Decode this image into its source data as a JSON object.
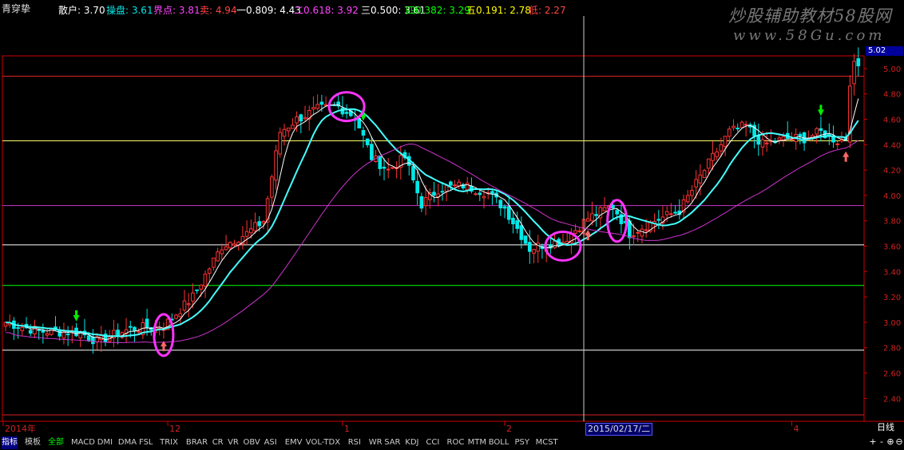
{
  "header": {
    "stock_name": "青穿挚",
    "retail": {
      "label": "散户:",
      "value": "3.70",
      "color": "#ffffff"
    },
    "operator": {
      "label": "操盘:",
      "value": "3.61",
      "color": "#00e8e8"
    },
    "boundary": {
      "label": "界点:",
      "value": "3.81",
      "color": "#ff44ff"
    },
    "sell": {
      "label": "卖:",
      "value": "4.94",
      "color": "#ff4444"
    },
    "fib1": {
      "label": "一0.809:",
      "value": "4.43",
      "color": "#ffffff"
    },
    "fib2": {
      "label": "二0.618:",
      "value": "3.92",
      "color": "#ff44ff"
    },
    "fib3": {
      "label": "三0.500:",
      "value": "3.61",
      "color": "#ffffff"
    },
    "fib4": {
      "label": "四0.382:",
      "value": "3.29",
      "color": "#00ff00"
    },
    "fib5": {
      "label": "五0.191:",
      "value": "2.78",
      "color": "#ffff00"
    },
    "low": {
      "label": "低:",
      "value": "2.27",
      "color": "#ff4444"
    }
  },
  "watermark": {
    "line1": "炒股辅助教材58股网",
    "line2": "www.58Gu.com"
  },
  "price_box": "5.02",
  "period_label": "日线",
  "cursor_date": "2015/02/17/二",
  "colors": {
    "up": "#ff3333",
    "down": "#00e8e8",
    "ma_white": "#ffffff",
    "ma_cyan": "#44ffff",
    "ma_magenta": "#cc33cc",
    "axis": "#cc0000"
  },
  "chart_data": {
    "type": "candlestick",
    "ylim": [
      2.27,
      5.1
    ],
    "y_ticks": [
      "5.00",
      "4.80",
      "4.60",
      "4.40",
      "4.20",
      "4.00",
      "3.80",
      "3.60",
      "3.40",
      "3.20",
      "3.00",
      "2.80",
      "2.60",
      "2.40"
    ],
    "x_labels": [
      {
        "label": "2014年",
        "index": 0
      },
      {
        "label": "12",
        "index": 39
      },
      {
        "label": "1",
        "index": 81
      },
      {
        "label": "2",
        "index": 120
      },
      {
        "label": "4",
        "index": 189
      }
    ],
    "cursor_index": 139,
    "reference_lines": [
      {
        "value": 4.94,
        "color": "#dd2222"
      },
      {
        "value": 4.43,
        "color": "#ffff66"
      },
      {
        "value": 3.92,
        "color": "#cc33cc"
      },
      {
        "value": 3.61,
        "color": "#ffffff"
      },
      {
        "value": 3.29,
        "color": "#00ff00"
      },
      {
        "value": 2.78,
        "color": "#ffffff"
      },
      {
        "value": 2.27,
        "color": "#dd2222"
      }
    ],
    "close_keys": [
      [
        0,
        3.0
      ],
      [
        8,
        2.93
      ],
      [
        18,
        2.92
      ],
      [
        22,
        2.85
      ],
      [
        30,
        2.95
      ],
      [
        38,
        2.97
      ],
      [
        45,
        3.2
      ],
      [
        52,
        3.6
      ],
      [
        58,
        3.7
      ],
      [
        62,
        3.8
      ],
      [
        66,
        4.5
      ],
      [
        70,
        4.6
      ],
      [
        75,
        4.68
      ],
      [
        80,
        4.7
      ],
      [
        84,
        4.62
      ],
      [
        88,
        4.3
      ],
      [
        92,
        4.2
      ],
      [
        96,
        4.3
      ],
      [
        100,
        3.93
      ],
      [
        104,
        4.05
      ],
      [
        110,
        4.08
      ],
      [
        116,
        4.02
      ],
      [
        120,
        3.9
      ],
      [
        126,
        3.58
      ],
      [
        130,
        3.62
      ],
      [
        134,
        3.64
      ],
      [
        140,
        3.82
      ],
      [
        146,
        3.92
      ],
      [
        150,
        3.7
      ],
      [
        156,
        3.8
      ],
      [
        162,
        3.88
      ],
      [
        168,
        4.2
      ],
      [
        174,
        4.5
      ],
      [
        178,
        4.55
      ],
      [
        182,
        4.4
      ],
      [
        188,
        4.45
      ],
      [
        192,
        4.45
      ],
      [
        196,
        4.5
      ],
      [
        200,
        4.43
      ],
      [
        202,
        4.45
      ],
      [
        203,
        4.9
      ],
      [
        204,
        5.02
      ]
    ],
    "signals": [
      {
        "type": "down_arrow",
        "index": 17
      },
      {
        "type": "up_arrow",
        "index": 38
      },
      {
        "type": "down_arrow",
        "index": 86
      },
      {
        "type": "up_arrow",
        "index": 140
      },
      {
        "type": "down_arrow",
        "index": 196
      },
      {
        "type": "up_arrow",
        "index": 202
      }
    ],
    "ellipses": [
      {
        "index": 38,
        "price": 2.9
      },
      {
        "index": 82,
        "price": 4.7
      },
      {
        "index": 134,
        "price": 3.6
      },
      {
        "index": 147,
        "price": 3.8
      }
    ]
  },
  "bottom_tabs": [
    "指标",
    "模板",
    "全部",
    "MACD",
    "DMI",
    "DMA",
    "FSL",
    "TRIX",
    "BRAR",
    "CR",
    "VR",
    "OBV",
    "ASI",
    "EMV",
    "VOL-TDX",
    "RSI",
    "WR",
    "SAR",
    "KDJ",
    "CCI",
    "ROC",
    "MTM",
    "BOLL",
    "PSY",
    "MCST"
  ],
  "controls": [
    "+",
    "-",
    "⊕",
    "⊖"
  ]
}
